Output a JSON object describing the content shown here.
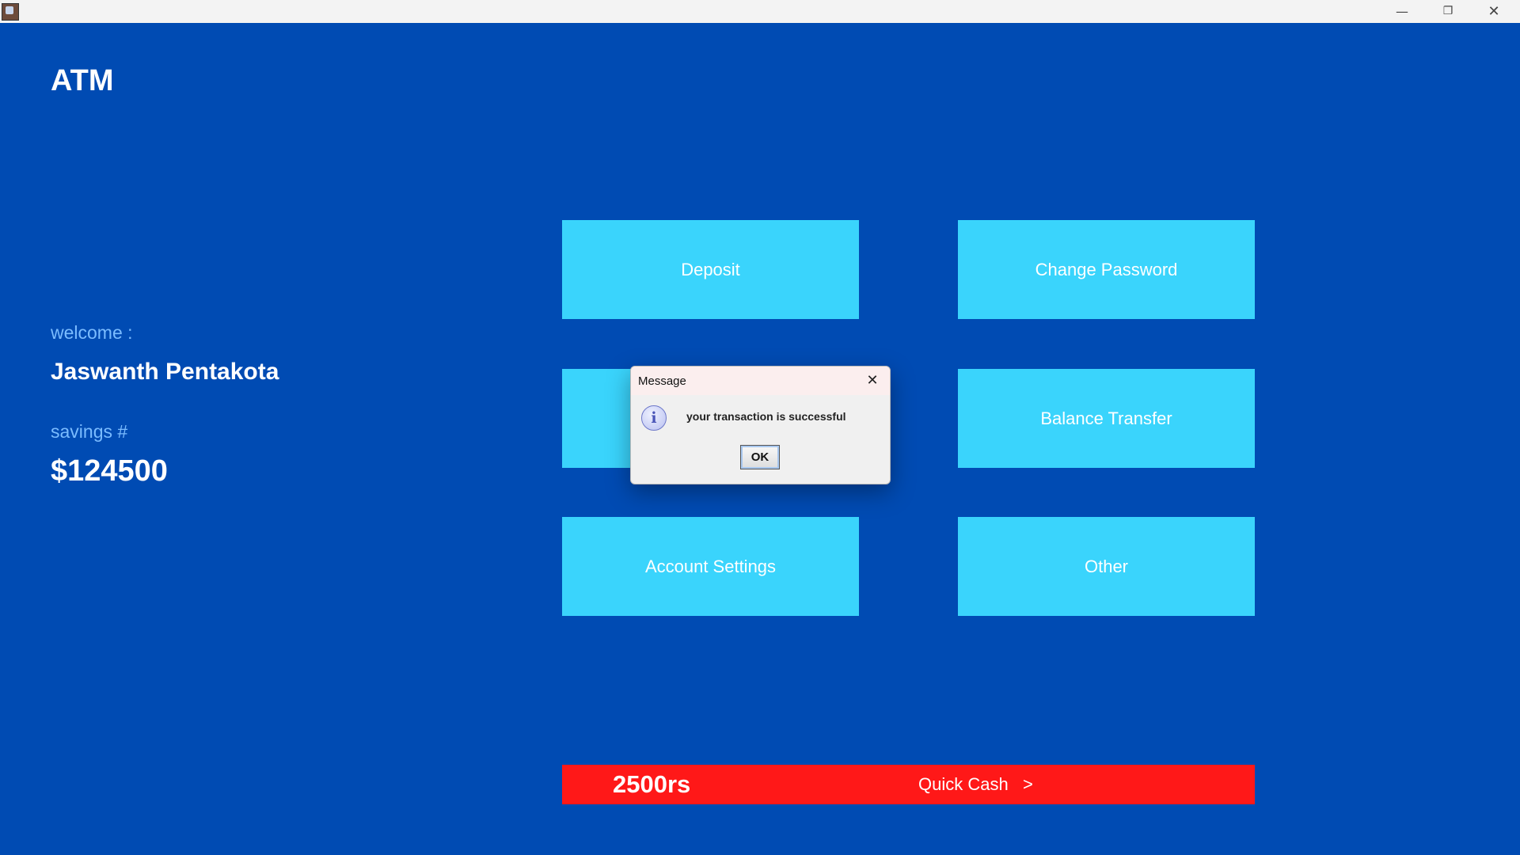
{
  "window": {
    "minimize_glyph": "—",
    "maximize_glyph": "❐",
    "close_glyph": "✕"
  },
  "header": {
    "title": "ATM"
  },
  "account": {
    "welcome_label": "welcome :",
    "name": "Jaswanth Pentakota",
    "savings_label": "savings #",
    "balance": "$124500"
  },
  "menu": {
    "deposit": "Deposit",
    "change_password": "Change Password",
    "withdraw": "",
    "balance_transfer": "Balance Transfer",
    "account_settings": "Account Settings",
    "other": "Other"
  },
  "quick_cash": {
    "amount": "2500rs",
    "label": "Quick Cash   >"
  },
  "dialog": {
    "title": "Message",
    "close_glyph": "✕",
    "icon_glyph": "i",
    "message": "your transaction is successful",
    "ok_label": "OK"
  },
  "colors": {
    "background": "#004bb3",
    "tile": "#3ad4fc",
    "quick_cash": "#ff1818",
    "label_accent": "#7bbcff"
  },
  "icons": [
    "app-icon",
    "minimize-icon",
    "maximize-icon",
    "close-icon",
    "info-icon"
  ]
}
